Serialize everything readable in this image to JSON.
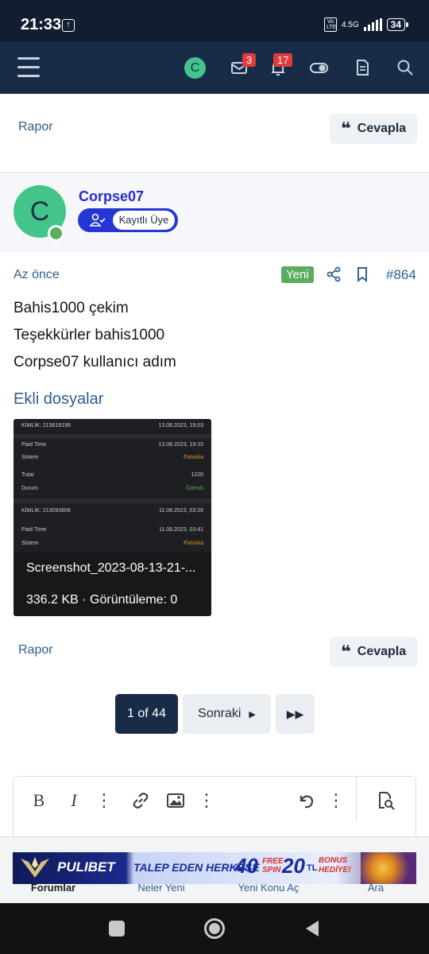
{
  "status_bar": {
    "time": "21:33",
    "network": "4.5G",
    "volte": "Vo LTE",
    "battery": "34"
  },
  "top_nav": {
    "user_initial": "C",
    "inbox_count": "3",
    "alerts_count": "17"
  },
  "prev_post_actions": {
    "report": "Rapor",
    "reply": "Cevapla"
  },
  "post": {
    "author": {
      "initial": "C",
      "name": "Corpse07",
      "role": "Kayıtlı Üye"
    },
    "time": "Az önce",
    "new_badge": "Yeni",
    "number": "#864",
    "lines": [
      "Bahis1000 çekim",
      "Teşekkürler bahis1000",
      "Corpse07 kullanıcı adım"
    ],
    "attachments_heading": "Ekli dosyalar",
    "attachment": {
      "filename": "Screenshot_2023-08-13-21-...",
      "meta": "336.2 KB · Görüntüleme: 0",
      "preview": {
        "kimlik1": "KİMLİK: 213819198",
        "date1": "13.08.2023, 19:03",
        "paid_time_label": "Paid Time",
        "paid1": "13.08.2023, 19:15",
        "sistem_label": "Sistem",
        "sistem_value": "Fixturka",
        "tutar_label": "Tutar",
        "tutar_value": "1220",
        "durum_label": "Durum",
        "durum_value": "Ödendi",
        "kimlik2": "KİMLİK: 213093806",
        "date2": "11.08.2023, 03:26",
        "paid2": "11.08.2023, 03:41"
      }
    },
    "report": "Rapor",
    "reply": "Cevapla"
  },
  "pagination": {
    "current": "1 of 44",
    "next": "Sonraki"
  },
  "bottom_nav": [
    "Forumlar",
    "Neler Yeni",
    "Yeni Konu Aç",
    "Ara"
  ],
  "ad": {
    "brand": "PULIBET",
    "talep": "TALEP EDEN HERKESE",
    "free_count": "40",
    "free_text": "FREE SPIN",
    "bonus_amount": "20",
    "currency": "TL",
    "bonus_text": "BONUS HEDİYE!"
  },
  "colors": {
    "nav_bg": "#182b47",
    "link": "#2f5d8f",
    "username": "#2a2ad0",
    "avatar": "#43c48a",
    "new_badge": "#5bab60",
    "pager_active": "#182b47"
  }
}
